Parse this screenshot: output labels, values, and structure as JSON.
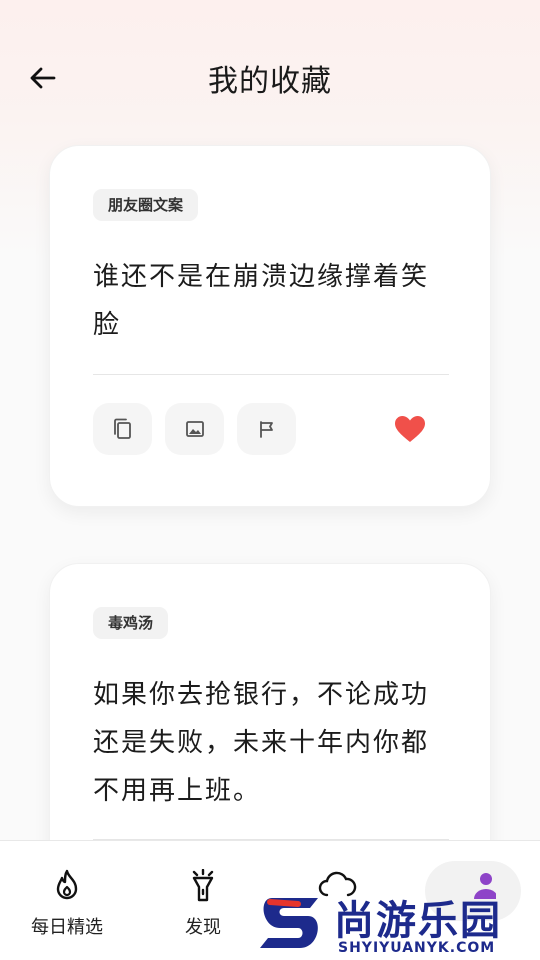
{
  "header": {
    "title": "我的收藏"
  },
  "cards": [
    {
      "tag": "朋友圈文案",
      "text": "谁还不是在崩溃边缘撑着笑脸",
      "favorited": true
    },
    {
      "tag": "毒鸡汤",
      "text": "如果你去抢银行，不论成功还是失败，未来十年内你都不用再上班。"
    }
  ],
  "bottom_nav": {
    "items": [
      {
        "label": "每日精选",
        "icon": "flame-icon"
      },
      {
        "label": "发现",
        "icon": "flashlight-icon"
      },
      {
        "label": "",
        "icon": "cloud-icon"
      },
      {
        "label": "",
        "icon": "person-icon",
        "active": true
      }
    ]
  },
  "watermark": {
    "name": "尚游乐园",
    "url": "SHYIYUANYK.COM"
  },
  "colors": {
    "heart": "#f0504a",
    "accent_purple": "#8e44c8",
    "watermark_blue": "#1d2a8c",
    "watermark_red": "#e5342c"
  }
}
